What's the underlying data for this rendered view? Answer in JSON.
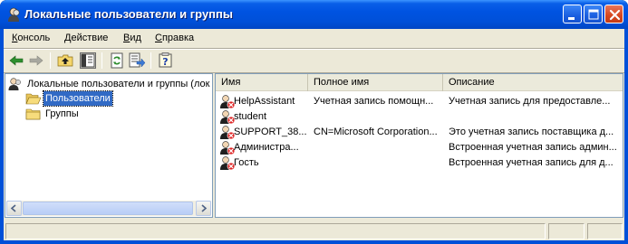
{
  "window": {
    "title": "Локальные пользователи и группы"
  },
  "menu": [
    {
      "label": "Консоль",
      "accel": "К",
      "rest": "онсоль"
    },
    {
      "label": "Действие",
      "accel": "Д",
      "rest": "ействие"
    },
    {
      "label": "Вид",
      "accel": "В",
      "rest": "ид"
    },
    {
      "label": "Справка",
      "accel": "С",
      "rest": "правка"
    }
  ],
  "toolbar": {
    "icons": [
      "back-arrow-icon",
      "forward-arrow-icon",
      "up-folder-icon",
      "show-hide-tree-icon",
      "refresh-icon",
      "export-list-icon",
      "help-icon"
    ]
  },
  "tree": {
    "root": "Локальные пользователи и группы (лок",
    "children": [
      {
        "label": "Пользователи",
        "selected": true
      },
      {
        "label": "Группы",
        "selected": false
      }
    ]
  },
  "list": {
    "columns": [
      "Имя",
      "Полное имя",
      "Описание"
    ],
    "rows": [
      {
        "name": "HelpAssistant",
        "full_name": "Учетная запись помощн...",
        "description": "Учетная запись для предоставле..."
      },
      {
        "name": "student",
        "full_name": "",
        "description": ""
      },
      {
        "name": "SUPPORT_38...",
        "full_name": "CN=Microsoft Corporation...",
        "description": "Это учетная запись поставщика д..."
      },
      {
        "name": "Администра...",
        "full_name": "",
        "description": "Встроенная учетная запись админ..."
      },
      {
        "name": "Гость",
        "full_name": "",
        "description": "Встроенная учетная запись для д..."
      }
    ]
  },
  "colors": {
    "titlebar": "#0054e3",
    "selection": "#316ac5",
    "face": "#ece9d8"
  }
}
